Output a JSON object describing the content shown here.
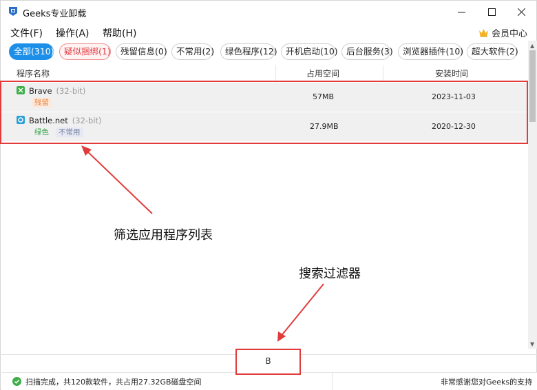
{
  "window": {
    "title": "Geeks专业卸载",
    "controls": {
      "minimize": "—",
      "maximize": "☐",
      "close": "✕"
    }
  },
  "menu": {
    "items": [
      "文件(F)",
      "操作(A)",
      "帮助(H)"
    ],
    "vip": "会员中心"
  },
  "filters": [
    {
      "label": "全部(310)",
      "state": "active"
    },
    {
      "label": "疑似捆绑(1)",
      "state": "warning"
    },
    {
      "label": "残留信息(0)",
      "state": "normal"
    },
    {
      "label": "不常用(2)",
      "state": "normal"
    },
    {
      "label": "绿色程序(12)",
      "state": "normal"
    },
    {
      "label": "开机启动(10)",
      "state": "normal"
    },
    {
      "label": "后台服务(3)",
      "state": "normal"
    },
    {
      "label": "浏览器插件(10)",
      "state": "normal"
    },
    {
      "label": "超大软件(2)",
      "state": "normal"
    }
  ],
  "table": {
    "columns": [
      "程序名称",
      "占用空间",
      "安装时间"
    ],
    "rows": [
      {
        "name": "Brave",
        "arch": "(32-bit)",
        "tags": [
          "残留"
        ],
        "size": "57MB",
        "installed": "2023-11-03",
        "icon": "brave-icon",
        "icon_color": "#3fae49"
      },
      {
        "name": "Battle.net",
        "arch": "(32-bit)",
        "tags": [
          "绿色",
          "不常用"
        ],
        "size": "27.9MB",
        "installed": "2020-12-30",
        "icon": "battlenet-icon",
        "icon_color": "#2a9fd6"
      }
    ]
  },
  "annotations": {
    "list_label": "筛选应用程序列表",
    "filter_label": "搜索过滤器",
    "color": "#e23b3b"
  },
  "search_filter": {
    "value": "B"
  },
  "status": {
    "scan_text": "扫描完成，共120款软件，共占用27.32GB磁盘空间",
    "thanks": "非常感谢您对Geeks的支持"
  },
  "colors": {
    "accent": "#1e8fe8",
    "warning": "#e0393e",
    "success": "#3fae49"
  }
}
